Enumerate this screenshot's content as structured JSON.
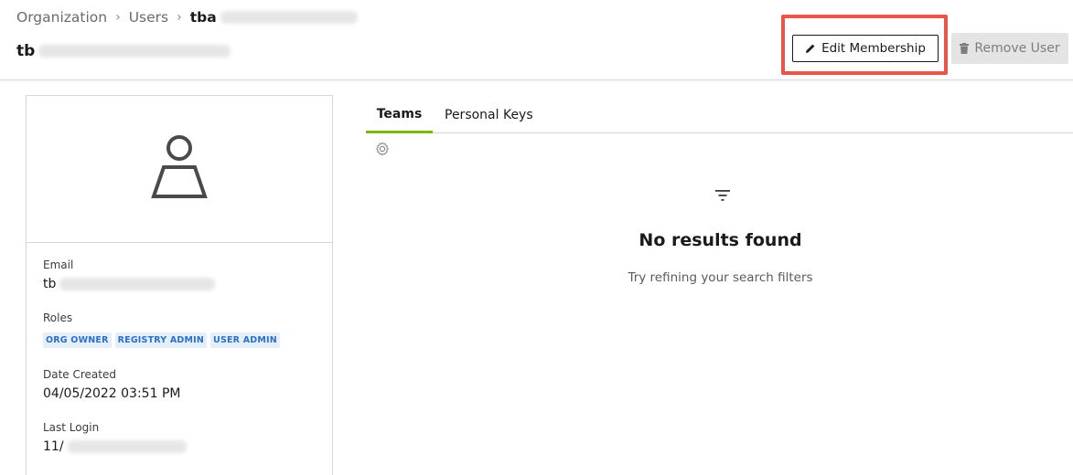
{
  "breadcrumb": {
    "items": [
      "Organization",
      "Users"
    ],
    "separator": "›",
    "current": "tba"
  },
  "page_title": "tb",
  "toolbar": {
    "edit_label": "Edit Membership",
    "remove_label": "Remove User",
    "edit_icon": "pencil-icon",
    "remove_icon": "trash-icon"
  },
  "profile": {
    "avatar_icon": "user-icon",
    "email_label": "Email",
    "email_value": "tb",
    "roles_label": "Roles",
    "roles": [
      "ORG OWNER",
      "REGISTRY ADMIN",
      "USER ADMIN"
    ],
    "date_created_label": "Date Created",
    "date_created_value": "04/05/2022 03:51 PM",
    "last_login_label": "Last Login",
    "last_login_value": "11/"
  },
  "tabs": [
    {
      "label": "Teams",
      "active": true
    },
    {
      "label": "Personal Keys",
      "active": false
    }
  ],
  "empty_state": {
    "icon": "filter-icon",
    "title": "No results found",
    "subtitle": "Try refining your search filters"
  },
  "colors": {
    "accent": "#76b900",
    "highlight": "#e8564a",
    "chip_bg": "#e5effa",
    "chip_text": "#2a6fc9"
  }
}
